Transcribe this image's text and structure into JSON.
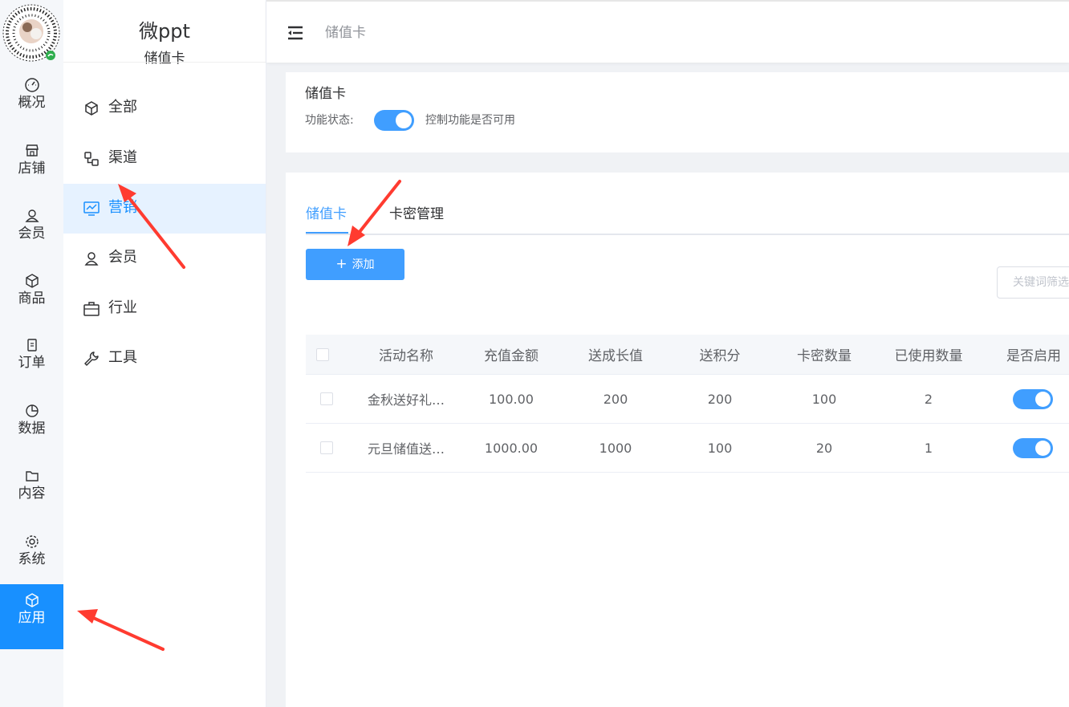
{
  "rail": {
    "items": [
      {
        "label": "概况",
        "icon": "dashboard-icon"
      },
      {
        "label": "店铺",
        "icon": "shop-icon"
      },
      {
        "label": "会员",
        "icon": "user-icon"
      },
      {
        "label": "商品",
        "icon": "box-icon"
      },
      {
        "label": "订单",
        "icon": "clipboard-icon"
      },
      {
        "label": "数据",
        "icon": "pie-chart-icon"
      },
      {
        "label": "内容",
        "icon": "folder-icon"
      },
      {
        "label": "系统",
        "icon": "gear-icon"
      },
      {
        "label": "应用",
        "icon": "cube-icon",
        "active": true
      }
    ]
  },
  "brand": {
    "name": "微ppt",
    "sub": "储值卡"
  },
  "side": {
    "items": [
      {
        "label": "全部",
        "icon": "cube-icon"
      },
      {
        "label": "渠道",
        "icon": "channel-icon"
      },
      {
        "label": "营销",
        "icon": "monitor-chart-icon",
        "active": true
      },
      {
        "label": "会员",
        "icon": "user-icon"
      },
      {
        "label": "行业",
        "icon": "briefcase-icon"
      },
      {
        "label": "工具",
        "icon": "wrench-icon"
      }
    ]
  },
  "header": {
    "breadcrumb": "储值卡"
  },
  "feature": {
    "title": "储值卡",
    "status_label": "功能状态:",
    "status_on": true,
    "status_desc": "控制功能是否可用"
  },
  "tabs": [
    {
      "label": "储值卡",
      "active": true
    },
    {
      "label": "卡密管理",
      "active": false
    }
  ],
  "toolbar": {
    "add_label": "添加",
    "filter_placeholder": "关键词筛选"
  },
  "table": {
    "columns": [
      "活动名称",
      "充值金额",
      "送成长值",
      "送积分",
      "卡密数量",
      "已使用数量",
      "是否启用"
    ],
    "rows": [
      {
        "name": "金秋送好礼…",
        "amount": "100.00",
        "growth": "200",
        "points": "200",
        "cards": "100",
        "used": "2",
        "enabled": true
      },
      {
        "name": "元旦储值送…",
        "amount": "1000.00",
        "growth": "1000",
        "points": "100",
        "cards": "20",
        "used": "1",
        "enabled": true
      }
    ]
  },
  "colors": {
    "accent": "#409eff",
    "rail_active": "#1890ff",
    "annotation": "#ff3b30"
  }
}
